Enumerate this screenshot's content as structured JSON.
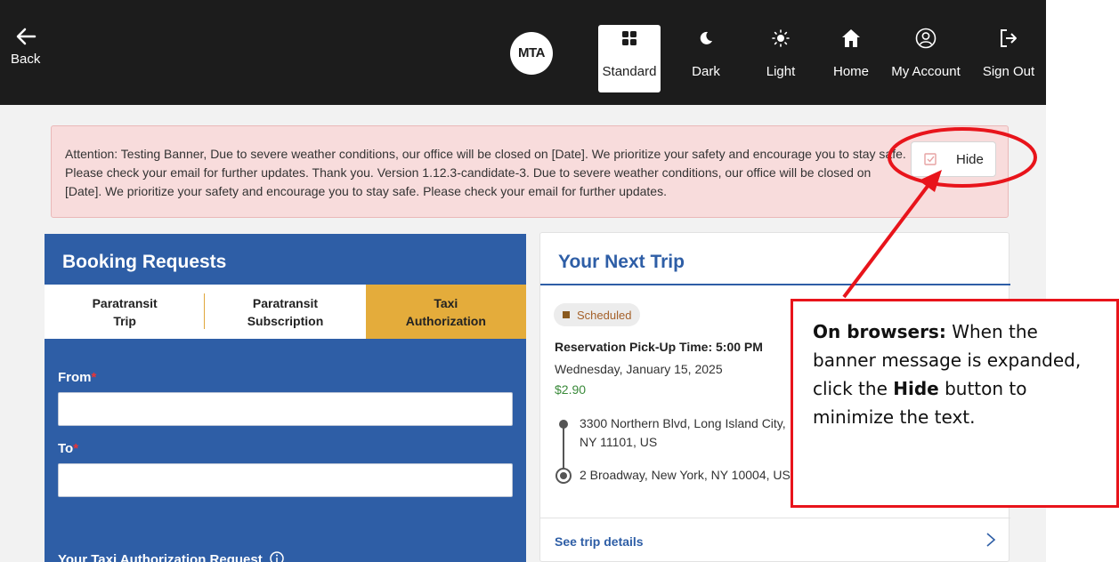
{
  "header": {
    "back_label": "Back",
    "logo_text": "MTA",
    "nav": [
      {
        "label": "Standard",
        "icon": "grid-icon"
      },
      {
        "label": "Dark",
        "icon": "moon-icon"
      },
      {
        "label": "Light",
        "icon": "sun-icon"
      },
      {
        "label": "Home",
        "icon": "home-icon"
      },
      {
        "label": "My Account",
        "icon": "account-icon"
      },
      {
        "label": "Sign Out",
        "icon": "sign-out-icon"
      }
    ],
    "active_nav": "Standard"
  },
  "banner": {
    "text": "Attention: Testing Banner, Due to severe weather conditions, our office will be closed on [Date]. We prioritize your safety and encourage you to stay safe. Please check your email for further updates. Thank you. Version 1.12.3-candidate-3. Due to severe weather conditions, our office will be closed on [Date]. We prioritize your safety and encourage you to stay safe. Please check your email for further updates.",
    "hide_label": "Hide"
  },
  "booking": {
    "title": "Booking Requests",
    "tabs": [
      "Paratransit Trip",
      "Paratransit Subscription",
      "Taxi Authorization"
    ],
    "active_tab": "Taxi Authorization",
    "from_label": "From",
    "to_label": "To",
    "required_mark": "*",
    "from_value": "",
    "to_value": "",
    "section_label": "Your Taxi Authorization Request"
  },
  "trip": {
    "title": "Your Next Trip",
    "status": "Scheduled",
    "pickup": "Reservation Pick-Up Time: 5:00 PM",
    "date": "Wednesday, January 15, 2025",
    "fare": "$2.90",
    "origin": "3300 Northern Blvd, Long Island City, NY 11101, US",
    "destination": "2 Broadway, New York, NY 10004, US",
    "details_link": "See trip details"
  },
  "annotation": {
    "lead_bold": "On browsers:",
    "text_1": " When the banner message is expanded, click the ",
    "bold_2": "Hide",
    "text_2": " button to minimize the text."
  },
  "colors": {
    "header_bg": "#1c1c1c",
    "brand_blue": "#2e5ea6",
    "active_tab": "#e4ac3b",
    "banner_bg": "#f8dcdc",
    "fare_green": "#3a8a3a",
    "annotation_red": "#e8141b"
  }
}
